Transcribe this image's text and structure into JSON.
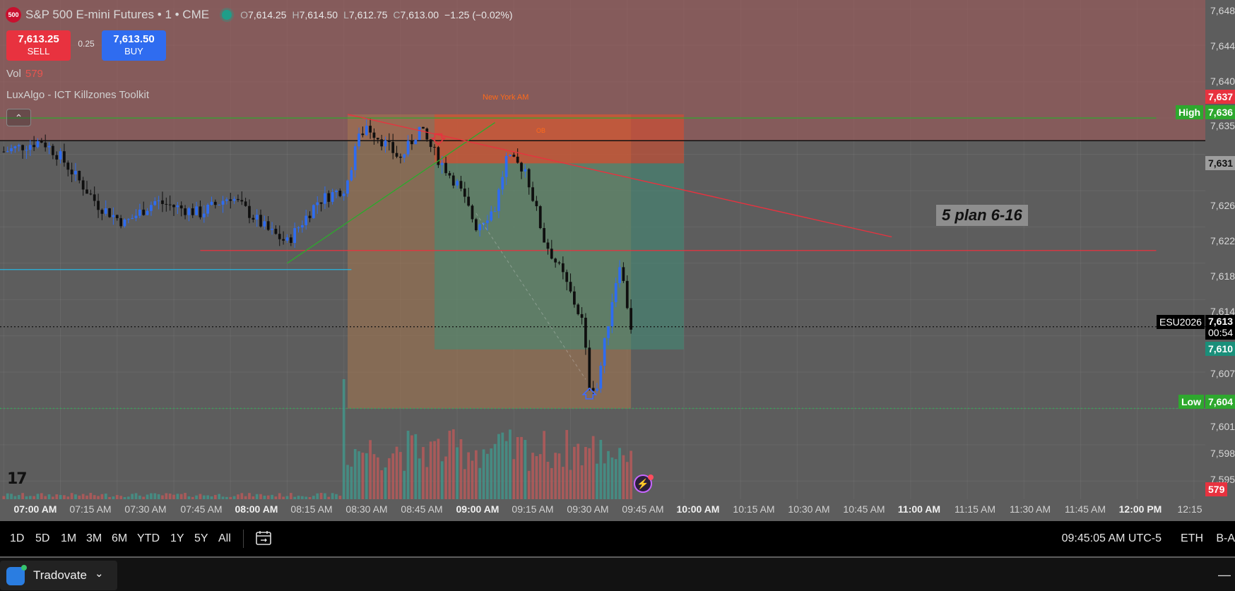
{
  "header": {
    "symbol_badge": "500",
    "title": "S&P 500 E-mini Futures • 1 • CME",
    "ohlc": {
      "o_label": "O",
      "o": "7,614.25",
      "h_label": "H",
      "h": "7,614.50",
      "l_label": "L",
      "l": "7,612.75",
      "c_label": "C",
      "c": "7,613.00",
      "change": "−1.25 (−0.02%)"
    }
  },
  "trade": {
    "sell_price": "7,613.25",
    "sell_label": "SELL",
    "spread": "0.25",
    "buy_price": "7,613.50",
    "buy_label": "BUY"
  },
  "volume": {
    "label": "Vol",
    "value": "579"
  },
  "indicator": {
    "name": "LuxAlgo - ICT Killzones Toolkit"
  },
  "annotations": {
    "new_york": "New York AM",
    "ob": "OB",
    "plan": "5 plan 6-16"
  },
  "price_axis": {
    "ticks": [
      "7,648",
      "7,644",
      "7,640",
      "7,635",
      "7,626",
      "7,622",
      "7,618",
      "7,614",
      "7,607",
      "7,601",
      "7,598",
      "7,595"
    ],
    "high_label": "High",
    "high_value": "7,636",
    "tag_637": "7,637",
    "tag_631": "7,631",
    "symbol": "ESU2026",
    "last_price": "7,613",
    "countdown": "00:54",
    "tag_610": "7,610",
    "low_label": "Low",
    "low_value": "7,604",
    "vol_value": "579"
  },
  "time_axis": {
    "labels": [
      {
        "t": "07:00 AM",
        "b": true
      },
      {
        "t": "07:15 AM",
        "b": false
      },
      {
        "t": "07:30 AM",
        "b": false
      },
      {
        "t": "07:45 AM",
        "b": false
      },
      {
        "t": "08:00 AM",
        "b": true
      },
      {
        "t": "08:15 AM",
        "b": false
      },
      {
        "t": "08:30 AM",
        "b": false
      },
      {
        "t": "08:45 AM",
        "b": false
      },
      {
        "t": "09:00 AM",
        "b": true
      },
      {
        "t": "09:15 AM",
        "b": false
      },
      {
        "t": "09:30 AM",
        "b": false
      },
      {
        "t": "09:45 AM",
        "b": false
      },
      {
        "t": "10:00 AM",
        "b": true
      },
      {
        "t": "10:15 AM",
        "b": false
      },
      {
        "t": "10:30 AM",
        "b": false
      },
      {
        "t": "10:45 AM",
        "b": false
      },
      {
        "t": "11:00 AM",
        "b": true
      },
      {
        "t": "11:15 AM",
        "b": false
      },
      {
        "t": "11:30 AM",
        "b": false
      },
      {
        "t": "11:45 AM",
        "b": false
      },
      {
        "t": "12:00 PM",
        "b": true
      },
      {
        "t": "12:15",
        "b": false
      }
    ]
  },
  "bottom_bar": {
    "ranges": [
      "1D",
      "5D",
      "1M",
      "3M",
      "6M",
      "YTD",
      "1Y",
      "5Y",
      "All"
    ],
    "time": "09:45:05 AM UTC-5",
    "session": "ETH",
    "extra": "B-A"
  },
  "taskbar": {
    "app_name": "Tradovate"
  },
  "chart_data": {
    "type": "candlestick",
    "ylim": [
      7594,
      7649
    ],
    "time_range": [
      "06:59",
      "12:18"
    ],
    "bar_interval_minutes": 1,
    "last_price": 7613.0,
    "high": 7636.0,
    "low": 7604.0,
    "anchors": [
      {
        "t": "07:00",
        "p": 7632.3
      },
      {
        "t": "07:10",
        "p": 7633.5
      },
      {
        "t": "07:15",
        "p": 7631.7
      },
      {
        "t": "07:25",
        "p": 7626.4
      },
      {
        "t": "07:32",
        "p": 7624.4
      },
      {
        "t": "07:40",
        "p": 7626.8
      },
      {
        "t": "07:52",
        "p": 7625.5
      },
      {
        "t": "08:00",
        "p": 7627.4
      },
      {
        "t": "08:10",
        "p": 7623.6
      },
      {
        "t": "08:15",
        "p": 7622.3
      },
      {
        "t": "08:23",
        "p": 7626.8
      },
      {
        "t": "08:31",
        "p": 7628.5
      },
      {
        "t": "08:33",
        "p": 7633.0
      },
      {
        "t": "08:36",
        "p": 7635.2
      },
      {
        "t": "08:42",
        "p": 7632.7
      },
      {
        "t": "08:45",
        "p": 7631.5
      },
      {
        "t": "08:50",
        "p": 7634.8
      },
      {
        "t": "08:55",
        "p": 7631.5
      },
      {
        "t": "09:00",
        "p": 7628.7
      },
      {
        "t": "09:05",
        "p": 7624.1
      },
      {
        "t": "09:10",
        "p": 7626.1
      },
      {
        "t": "09:13",
        "p": 7631.5
      },
      {
        "t": "09:18",
        "p": 7630.4
      },
      {
        "t": "09:23",
        "p": 7622.6
      },
      {
        "t": "09:28",
        "p": 7618.6
      },
      {
        "t": "09:33",
        "p": 7613.7
      },
      {
        "t": "09:35",
        "p": 7606.7
      },
      {
        "t": "09:37",
        "p": 7606.3
      },
      {
        "t": "09:41",
        "p": 7616.0
      },
      {
        "t": "09:43",
        "p": 7620.2
      },
      {
        "t": "09:46",
        "p": 7613.0
      }
    ],
    "lines": [
      {
        "name": "high-line",
        "price": 7636.0,
        "from": "06:59",
        "to": "12:05",
        "color": "#2ea82e"
      },
      {
        "name": "red-resistance-line",
        "price": 7621.4,
        "from": "07:52",
        "to": "12:05",
        "color": "#e8323f"
      },
      {
        "name": "cyan-line",
        "price": 7619.3,
        "from": "06:59",
        "to": "08:32",
        "color": "#27b6e0"
      },
      {
        "name": "black-line",
        "price": 7633.5,
        "from": "06:59",
        "to": "12:18",
        "color": "#111111"
      },
      {
        "name": "low-dotted-line",
        "price": 7604.0,
        "from": "06:59",
        "to": "12:18",
        "color": "#37a65a"
      },
      {
        "name": "current-price-line",
        "price": 7613.0,
        "from": "06:59",
        "to": "12:18",
        "color": "#111111"
      }
    ],
    "trendlines": [
      {
        "name": "green-trendline",
        "t1": "08:15",
        "p1": 7620.0,
        "t2": "09:10",
        "p2": 7635.5,
        "color": "#2ea82e"
      },
      {
        "name": "red-trendline",
        "t1": "08:31",
        "p1": 7636.4,
        "t2": "10:55",
        "p2": 7622.9,
        "color": "#e8323f"
      }
    ],
    "zones": [
      {
        "name": "killzone-top-zone",
        "t1": "06:59",
        "t2": "12:18",
        "p1": 7649,
        "p2": 7633.5,
        "color": "#a05a5a"
      },
      {
        "name": "ny-am-session-box",
        "t1": "08:31",
        "t2": "09:46",
        "p1": 7636.4,
        "p2": 7604.0,
        "color": "#a5764e"
      },
      {
        "name": "order-block-zone",
        "t1": "08:54",
        "t2": "10:00",
        "p1": 7636.4,
        "p2": 7631.0,
        "color": "#e04a2a"
      },
      {
        "name": "profit-zone",
        "t1": "08:54",
        "t2": "10:00",
        "p1": 7631.0,
        "p2": 7610.5,
        "color": "#3f8d76"
      }
    ],
    "markers": [
      {
        "name": "sell-arrow-marker",
        "t": "08:55",
        "p": 7633.7,
        "dir": "down",
        "color": "#e8323f"
      },
      {
        "name": "buy-arrow-marker",
        "t": "09:35",
        "p": 7605.6,
        "dir": "up",
        "color": "#3d6bff"
      }
    ],
    "volume_series_start": "08:30"
  }
}
